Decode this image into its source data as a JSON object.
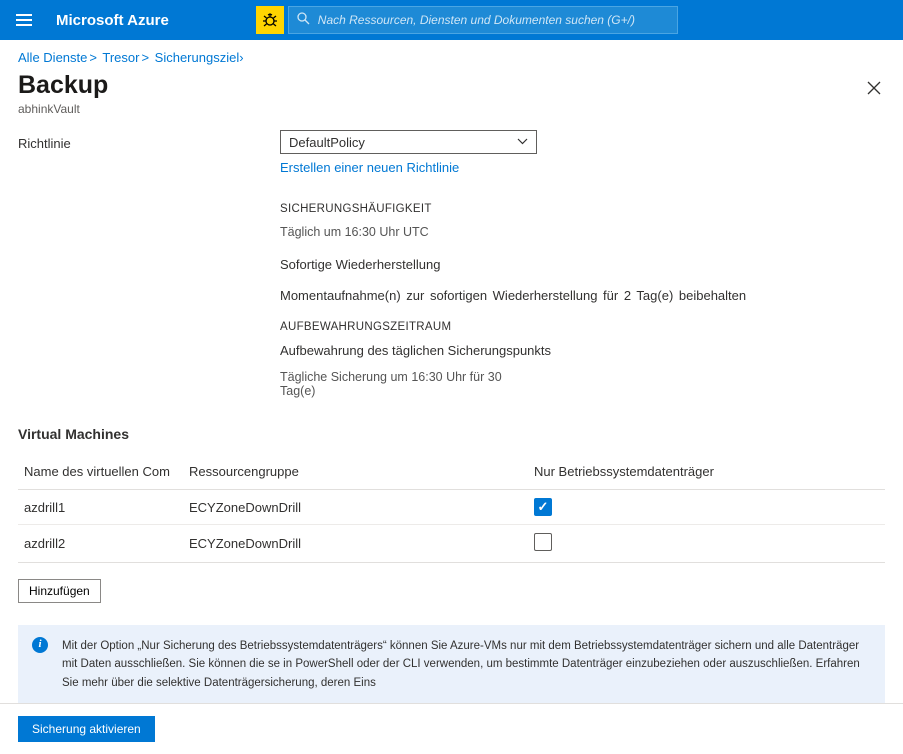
{
  "header": {
    "brand": "Microsoft Azure",
    "search_placeholder": "Nach Ressourcen, Diensten und Dokumenten suchen (G+/)"
  },
  "breadcrumb": {
    "items": [
      "Alle Dienste",
      "Tresor",
      "Sicherungsziel"
    ]
  },
  "page": {
    "title": "Backup",
    "subtitle": "abhinkVault"
  },
  "policy": {
    "label": "Richtlinie",
    "selected": "DefaultPolicy",
    "create_link": "Erstellen einer neuen Richtlinie"
  },
  "details": {
    "frequency_heading": "SICHERUNGSHÄUFIGKEIT",
    "frequency_text": "Täglich um 16:30 Uhr UTC",
    "instant_restore_heading": "Sofortige Wiederherstellung",
    "instant_restore_text": "Momentaufnahme(n) zur sofortigen Wiederherstellung für 2 Tag(e) beibehalten",
    "retention_heading": "AUFBEWAHRUNGSZEITRAUM",
    "retention_text": "Aufbewahrung des täglichen Sicherungspunkts",
    "retention_detail": "Tägliche Sicherung um 16:30 Uhr für 30 Tag(e)"
  },
  "vm_section": {
    "title": "Virtual Machines",
    "columns": {
      "name": "Name des virtuellen Com",
      "rg": "Ressourcengruppe",
      "osonly": "Nur Betriebssystemdatenträger"
    },
    "rows": [
      {
        "name": "azdrill1",
        "rg": "ECYZoneDownDrill",
        "checked": true
      },
      {
        "name": "azdrill2",
        "rg": "ECYZoneDownDrill",
        "checked": false
      }
    ],
    "add_button": "Hinzufügen"
  },
  "info_banner": "Mit der Option „Nur Sicherung des Betriebssystemdatenträgers“ können Sie Azure-VMs nur mit dem Betriebssystemdatenträger sichern und alle Datenträger mit Daten ausschließen. Sie können die se in PowerShell oder der CLI verwenden, um bestimmte Datenträger einzubeziehen oder auszuschließen. Erfahren Sie mehr über die selektive Datenträgersicherung, deren Eins",
  "footer": {
    "enable_button": "Sicherung aktivieren"
  }
}
